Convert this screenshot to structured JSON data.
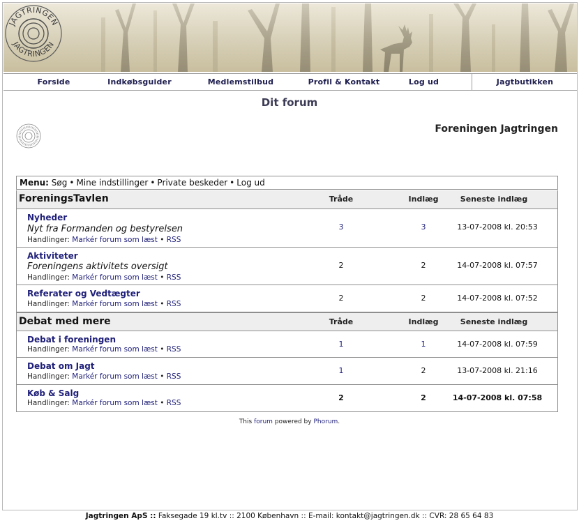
{
  "banner": {
    "logo_text_top": "JAGTRINGEN",
    "logo_text_bottom": "JAGTRINGEN"
  },
  "nav": {
    "items": [
      "Forside",
      "Indkøbsguider",
      "Medlemstilbud",
      "Profil & Kontakt",
      "Log ud",
      "Jagtbutikken"
    ]
  },
  "page": {
    "title": "Dit forum",
    "org_name": "Foreningen Jagtringen"
  },
  "menu": {
    "label": "Menu:",
    "items": [
      "Søg",
      "Mine indstillinger",
      "Private beskeder",
      "Log ud"
    ],
    "separator": "•"
  },
  "sections": [
    {
      "title": "ForeningsTavlen",
      "col_threads": "Tråde",
      "col_posts": "Indlæg",
      "col_latest": "Seneste indlæg",
      "forums": [
        {
          "name": "Nyheder",
          "description": "Nyt fra Formanden og bestyrelsen",
          "threads": "3",
          "posts": "3",
          "latest": "13-07-2008 kl. 20:53"
        },
        {
          "name": "Aktiviteter",
          "description": "Foreningens aktivitets oversigt",
          "threads": "2",
          "posts": "2",
          "latest": "14-07-2008 kl. 07:57"
        },
        {
          "name": "Referater og Vedtægter",
          "description": "",
          "threads": "2",
          "posts": "2",
          "latest": "14-07-2008 kl. 07:52"
        }
      ]
    },
    {
      "title": "Debat med mere",
      "col_threads": "Tråde",
      "col_posts": "Indlæg",
      "col_latest": "Seneste indlæg",
      "forums": [
        {
          "name": "Debat i foreningen",
          "description": "",
          "threads": "1",
          "posts": "1",
          "latest": "14-07-2008 kl. 07:59"
        },
        {
          "name": "Debat om Jagt",
          "description": "",
          "threads": "1",
          "posts": "2",
          "latest": "13-07-2008 kl. 21:16"
        },
        {
          "name": "Køb & Salg",
          "description": "",
          "threads": "2",
          "posts": "2",
          "latest": "14-07-2008 kl. 07:58"
        }
      ]
    }
  ],
  "actions": {
    "label": "Handlinger:",
    "mark_read": "Markér forum som læst",
    "rss": "RSS",
    "separator": "•"
  },
  "powered": {
    "prefix": "This",
    "forum_link": "forum",
    "middle": "powered by",
    "phorum_link": "Phorum",
    "suffix": "."
  },
  "footer": {
    "company": "Jagtringen ApS ::",
    "address": "Faksegade 19 kl.tv :: 2100 København :: E-mail: kontakt@jagtringen.dk :: CVR: 28 65 64 83"
  },
  "colors": {
    "link": "#20207a",
    "section_bg": "#eeeeee",
    "border": "#8e8e8e"
  }
}
